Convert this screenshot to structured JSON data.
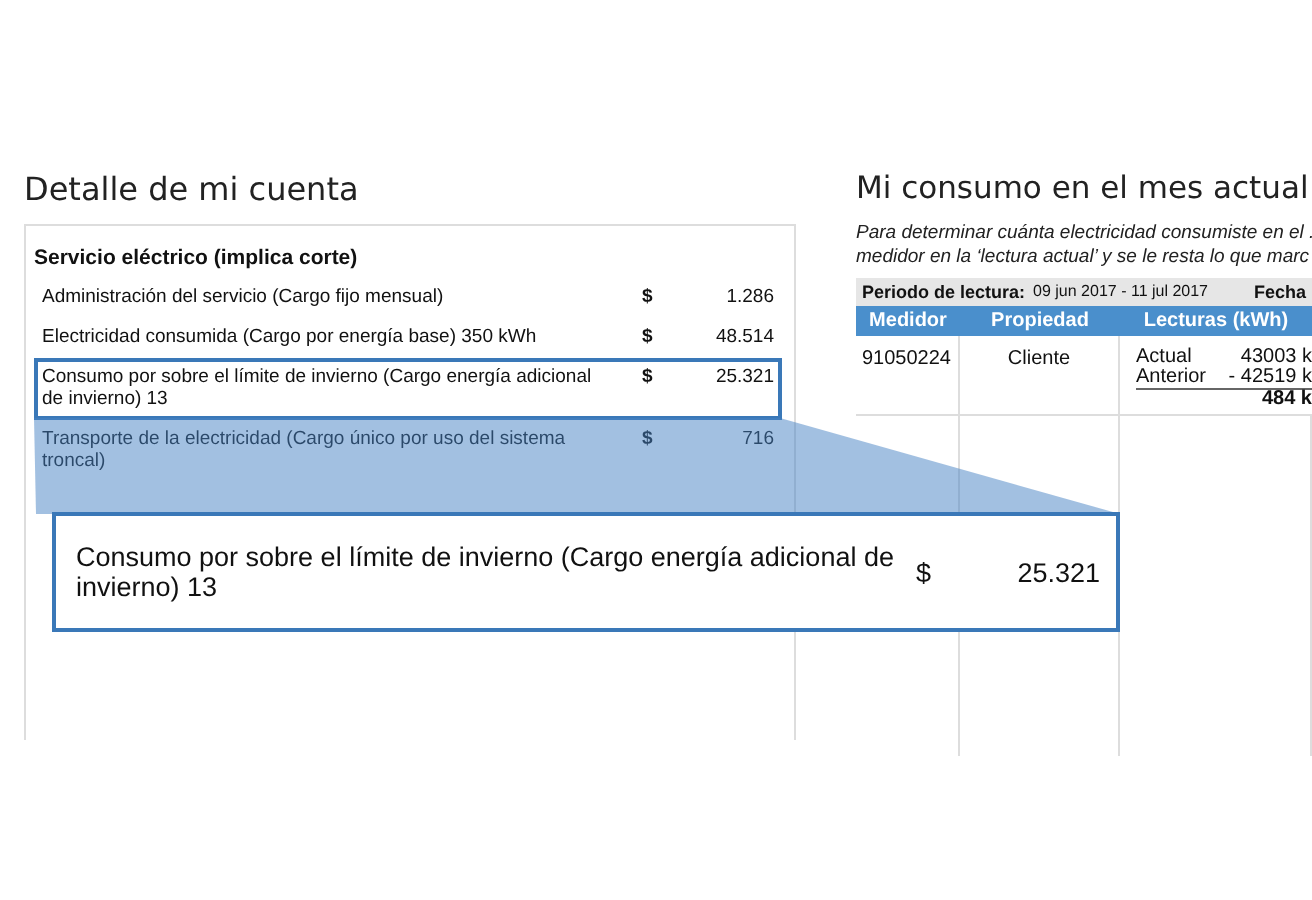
{
  "account_detail": {
    "title": "Detalle de mi cuenta",
    "section_title": "Servicio eléctrico (implica corte)",
    "charges": [
      {
        "description": "Administración del servicio (Cargo fijo mensual)",
        "currency": "$",
        "amount": "1.286",
        "highlighted": false
      },
      {
        "description": "Electricidad consumida (Cargo por energía base) 350 kWh",
        "currency": "$",
        "amount": "48.514",
        "highlighted": false
      },
      {
        "description": "Consumo por sobre el límite de invierno (Cargo energía adicional de invierno) 13",
        "currency": "$",
        "amount": "25.321",
        "highlighted": true
      },
      {
        "description": "Transporte de la electricidad (Cargo único por uso del sistema troncal)",
        "currency": "$",
        "amount": "716",
        "highlighted": false
      }
    ]
  },
  "magnifier": {
    "description": "Consumo por sobre el límite de invierno (Cargo energía adicional de invierno) 13",
    "currency": "$",
    "amount": "25.321"
  },
  "consumption": {
    "title": "Mi consumo en el mes actual",
    "intro_lines": [
      "Para determinar cuánta electricidad consumiste en el .",
      "medidor en la ‘lectura actual’ y se le resta lo que marc"
    ],
    "period_label": "Periodo de lectura:",
    "period_value": "09 jun 2017 - 11 jul 2017",
    "date_label": "Fecha",
    "columns": [
      "Medidor",
      "Propiedad",
      "Lecturas (kWh)"
    ],
    "rows": [
      {
        "meter": "91050224",
        "ownership": "Cliente",
        "readings": [
          {
            "label": "Actual",
            "value": "43003 k"
          },
          {
            "label": "Anterior",
            "value": "- 42519 k"
          }
        ],
        "total": "484 k"
      }
    ]
  }
}
